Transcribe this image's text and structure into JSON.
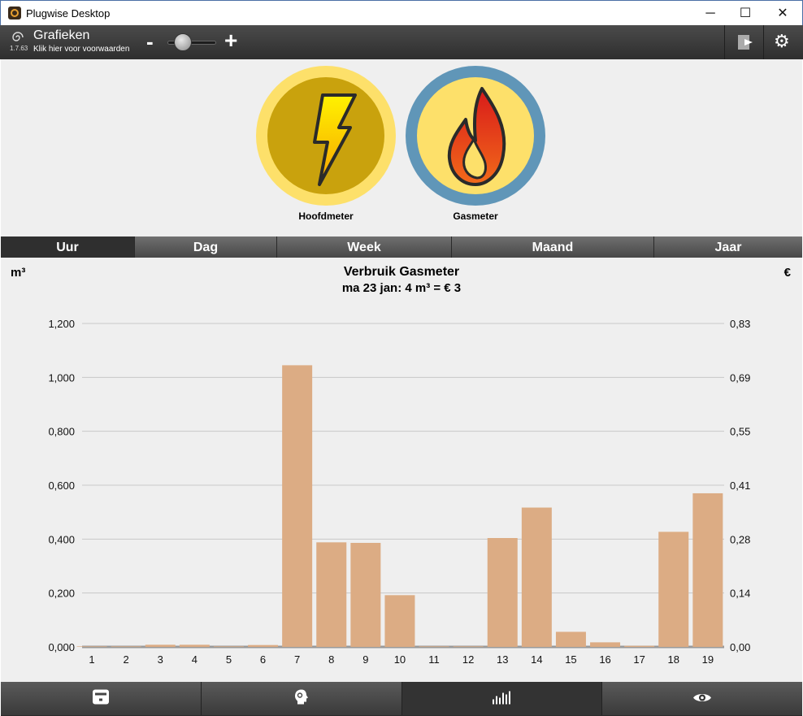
{
  "window": {
    "title": "Plugwise Desktop",
    "minimize": "─",
    "maximize": "☐",
    "close": "✕"
  },
  "toolbar": {
    "title": "Grafieken",
    "version": "1.7.63",
    "subtitle": "Klik hier voor voorwaarden",
    "zoom_out": "-",
    "zoom_in": "+",
    "icons": [
      "logo-icon",
      "export-icon",
      "settings-icon"
    ]
  },
  "meters": [
    {
      "label": "Hoofdmeter",
      "icon": "lightning-icon",
      "ring_color": "#fde06a",
      "inner_color": "#c9a20d",
      "selected": false
    },
    {
      "label": "Gasmeter",
      "icon": "flame-icon",
      "ring_color": "#6096b8",
      "inner_color": "#fde06a",
      "selected": true
    }
  ],
  "tabs": [
    "Uur",
    "Dag",
    "Week",
    "Maand",
    "Jaar"
  ],
  "active_tab": "Uur",
  "chart_data": {
    "type": "bar",
    "title": "Verbruik Gasmeter",
    "subtitle": "ma 23 jan: 4 m³ = € 3",
    "ylabel": "m³",
    "y2label": "€",
    "categories": [
      "1",
      "2",
      "3",
      "4",
      "5",
      "6",
      "7",
      "8",
      "9",
      "10",
      "11",
      "12",
      "13",
      "14",
      "15",
      "16",
      "17",
      "18",
      "19"
    ],
    "values": [
      0.002,
      0.002,
      0.008,
      0.008,
      0.002,
      0.007,
      1.045,
      0.388,
      0.386,
      0.192,
      0.002,
      0.002,
      0.404,
      0.517,
      0.056,
      0.017,
      0.004,
      0.427,
      0.57
    ],
    "ylim": [
      0,
      1.2
    ],
    "y_ticks": [
      "0,000",
      "0,200",
      "0,400",
      "0,600",
      "0,800",
      "1,000",
      "1,200"
    ],
    "y2_ticks": [
      "0,00",
      "0,14",
      "0,28",
      "0,41",
      "0,55",
      "0,69",
      "0,83"
    ],
    "bar_color": "#dcac84",
    "grid": true
  },
  "bottom_nav": [
    {
      "icon": "meter-icon",
      "active": false
    },
    {
      "icon": "head-icon",
      "active": false
    },
    {
      "icon": "chart-icon",
      "active": true
    },
    {
      "icon": "eye-icon",
      "active": false
    }
  ]
}
